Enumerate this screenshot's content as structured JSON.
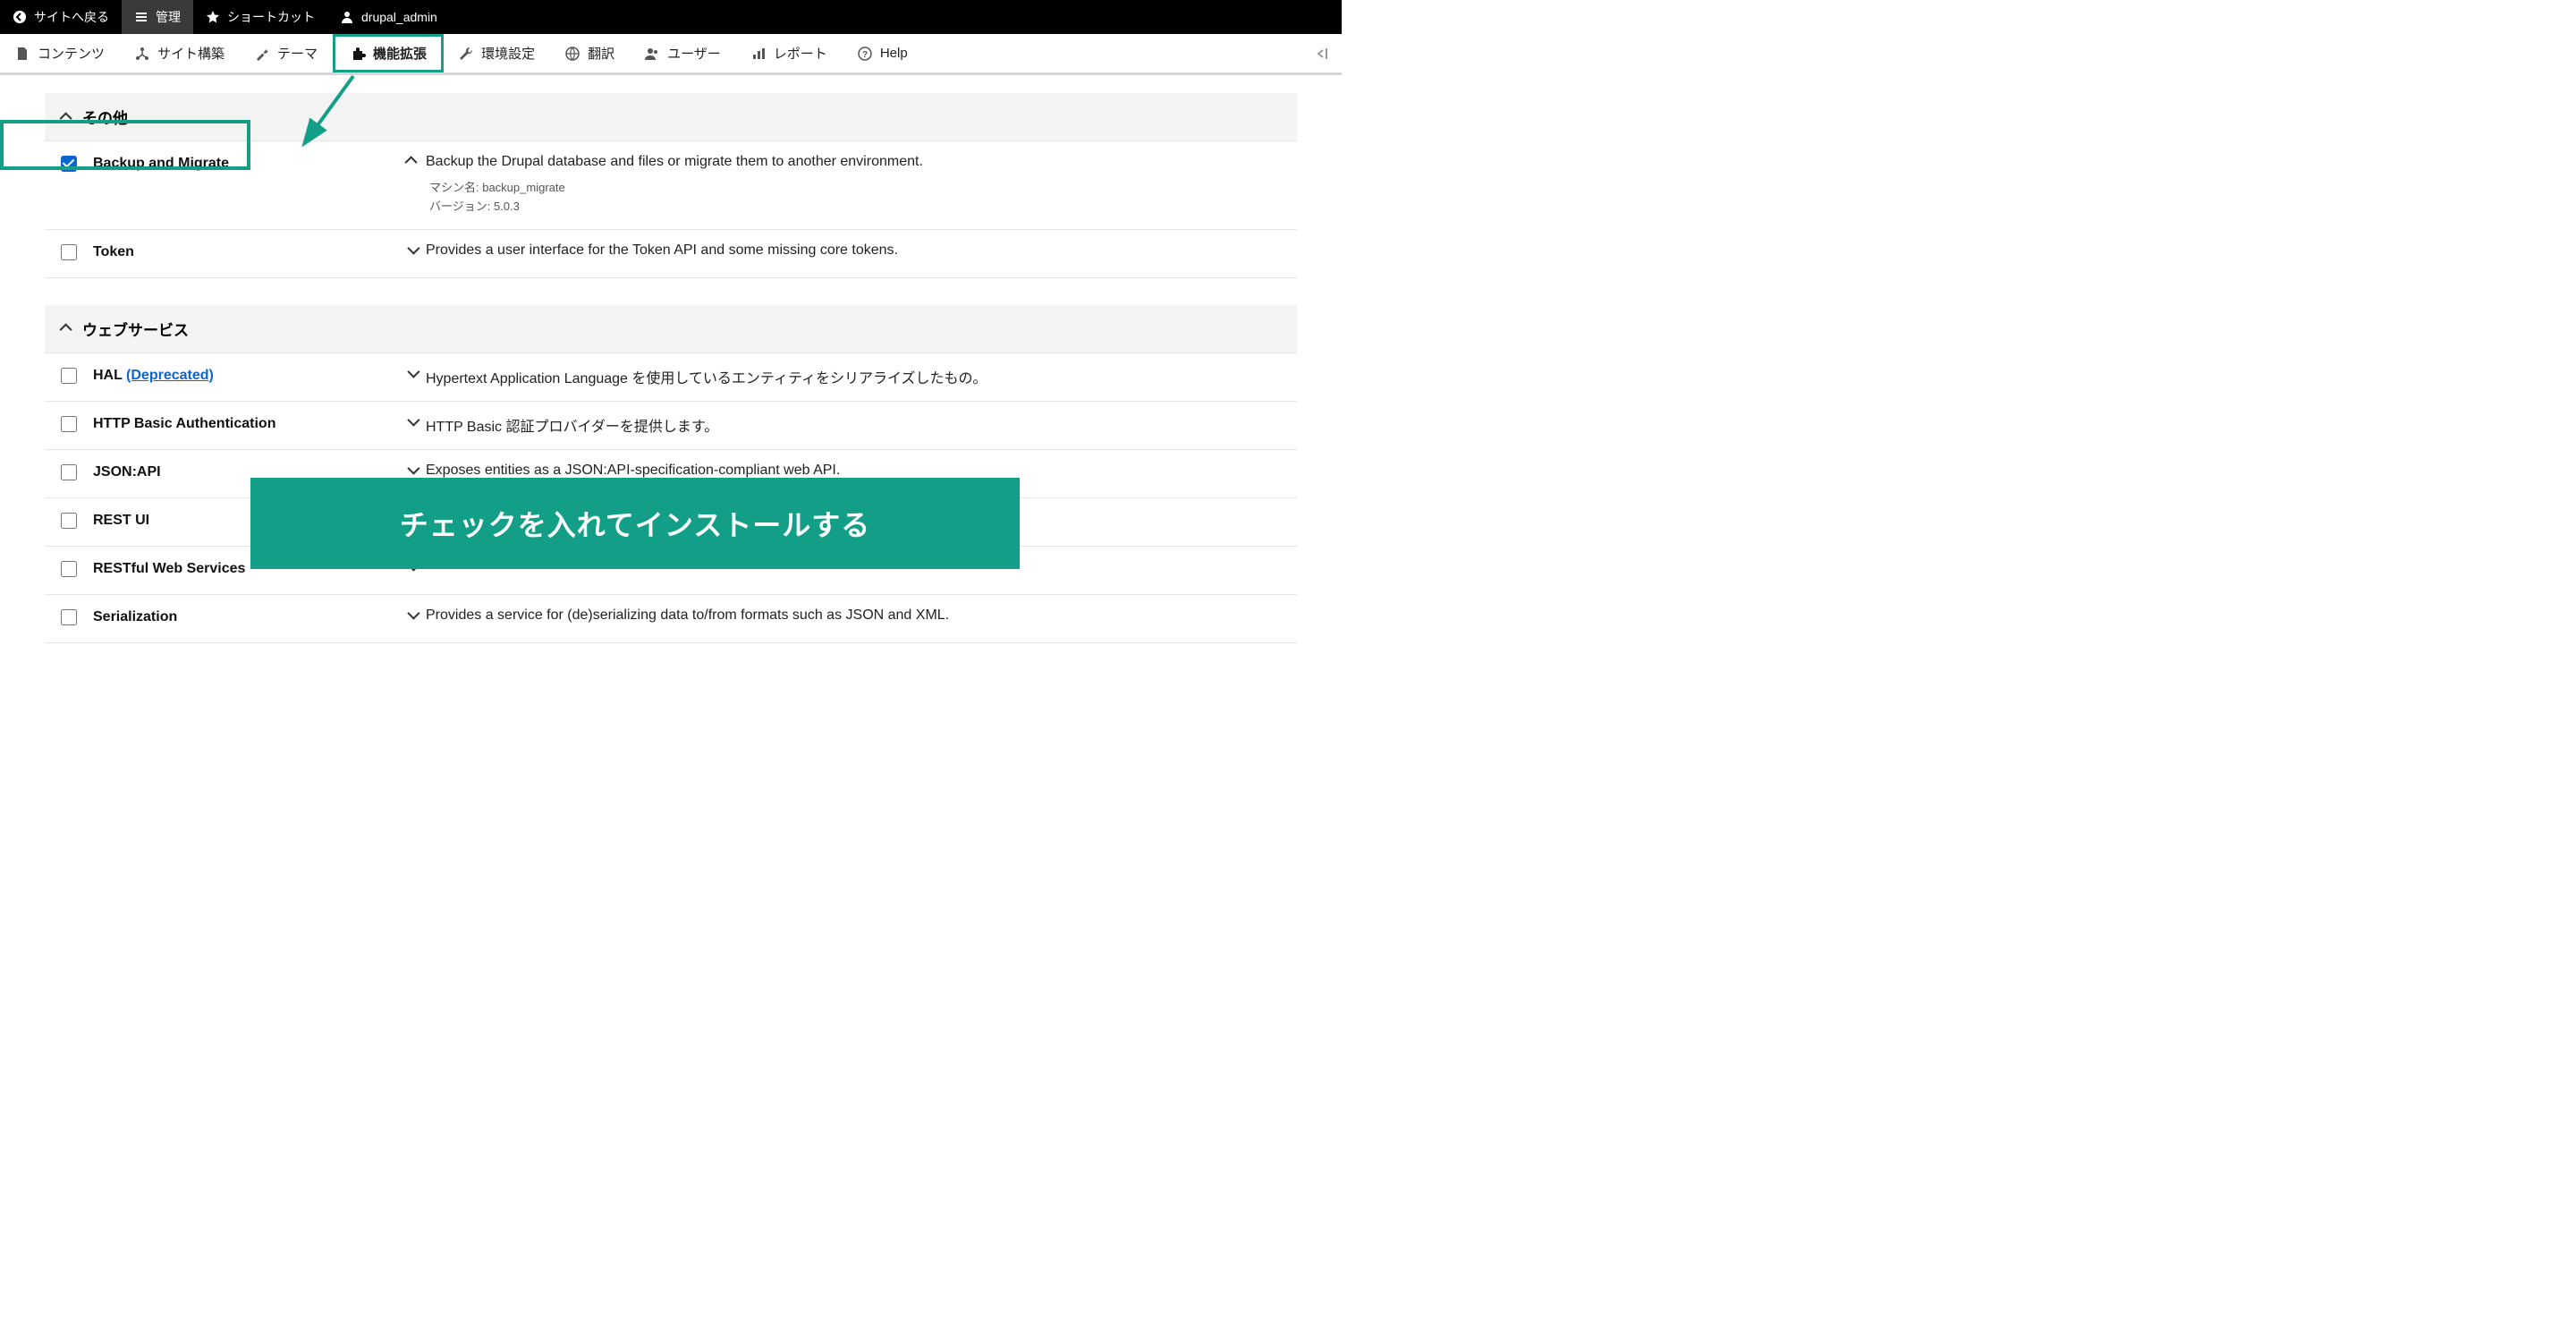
{
  "topbar": {
    "back": "サイトへ戻る",
    "manage": "管理",
    "shortcuts": "ショートカット",
    "user": "drupal_admin"
  },
  "tabs": {
    "content": "コンテンツ",
    "structure": "サイト構築",
    "appearance": "テーマ",
    "extend": "機能拡張",
    "config": "環境設定",
    "translate": "翻訳",
    "people": "ユーザー",
    "reports": "レポート",
    "help": "Help"
  },
  "sections": {
    "other": "その他",
    "webservices": "ウェブサービス"
  },
  "modules": {
    "backup": {
      "name": "Backup and Migrate",
      "desc": "Backup the Drupal database and files or migrate them to another environment.",
      "machine_label": "マシン名: backup_migrate",
      "version_label": "バージョン: 5.0.3"
    },
    "token": {
      "name": "Token",
      "desc": "Provides a user interface for the Token API and some missing core tokens."
    },
    "hal": {
      "name": "HAL",
      "dep": "(Deprecated)",
      "desc": "Hypertext Application Language を使用しているエンティティをシリアライズしたもの。"
    },
    "basicauth": {
      "name": "HTTP Basic Authentication",
      "desc": "HTTP Basic 認証プロバイダーを提供します。"
    },
    "jsonapi": {
      "name": "JSON:API",
      "desc": "Exposes entities as a JSON:API-specification-compliant web API."
    },
    "restui": {
      "name": "REST UI",
      "desc": ""
    },
    "restful": {
      "name": "RESTful Web Services",
      "desc": ""
    },
    "serialization": {
      "name": "Serialization",
      "desc": "Provides a service for (de)serializing data to/from formats such as JSON and XML."
    }
  },
  "annotation": "チェックを入れてインストールする"
}
